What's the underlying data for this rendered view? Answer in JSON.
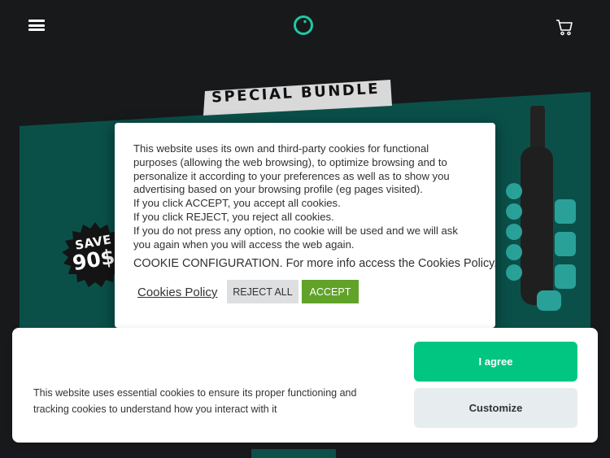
{
  "header": {
    "menu_icon": "hamburger-menu-icon",
    "logo_icon": "circle-logo-icon",
    "cart_icon": "shopping-cart-icon"
  },
  "hero": {
    "bundle_label": "SPECIAL BUNDLE",
    "save_label": "SAVE",
    "save_amount": "90$",
    "accent_color": "#0a5049"
  },
  "cookie_modal": {
    "paragraphs": [
      "This website uses its own and third-party cookies for functional",
      "purposes (allowing the web browsing), to optimize browsing and to",
      "personalize it according to your preferences as well as to show you",
      "advertising based on your browsing profile (eg pages visited).",
      "If you click ACCEPT, you accept all cookies.",
      "If you click REJECT, you reject all cookies.",
      "If you do not press any option, no cookie will be used and we will ask",
      "you again when you will access the web again."
    ],
    "config_text": "COOKIE CONFIGURATION. For more info access the Cookies Policy.",
    "policy_link": "Cookies Policy",
    "reject_label": "REJECT ALL",
    "accept_label": "ACCEPT"
  },
  "consent_bar": {
    "text": "This website uses essential cookies to ensure its proper functioning and tracking cookies to understand how you interact with it",
    "agree_label": "I agree",
    "customize_label": "Customize",
    "agree_color": "#00c681"
  }
}
